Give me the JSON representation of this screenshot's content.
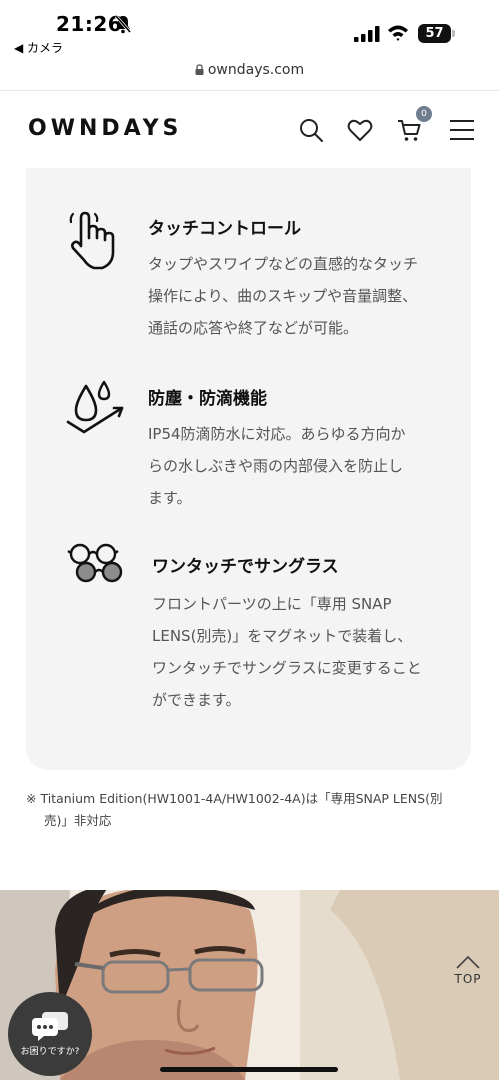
{
  "status_bar": {
    "time": "21:26",
    "back_label": "◀ カメラ",
    "battery": "57"
  },
  "browser": {
    "url": "owndays.com"
  },
  "header": {
    "logo": "OWNDAYS",
    "cart_count": "0"
  },
  "features": [
    {
      "icon": "touch-hand-icon",
      "title": "タッチコントロール",
      "lines": [
        "タップやスワイプなどの直感的なタッチ",
        "操作により、曲のスキップや音量調整、",
        "通話の応答や終了などが可能。"
      ]
    },
    {
      "icon": "water-drop-icon",
      "title": "防塵・防滴機能",
      "lines": [
        "IP54防滴防水に対応。あらゆる方向か",
        "らの水しぶきや雨の内部侵入を防止し",
        "ます。"
      ]
    },
    {
      "icon": "sunglasses-icon",
      "title": "ワンタッチでサングラス",
      "lines": [
        "フロントパーツの上に「専用 SNAP",
        "LENS(別売)」をマグネットで装着し、",
        "ワンタッチでサングラスに変更すること",
        "ができます。"
      ]
    }
  ],
  "footnote": "※ Titanium Edition(HW1001-4A/HW1002-4A)は「専用SNAP LENS(別売)」非対応",
  "floating": {
    "top_label": "TOP",
    "help_label": "お困りですか?"
  },
  "colors": {
    "card_bg": "#f4f4f4",
    "badge": "#6f7e8c"
  }
}
